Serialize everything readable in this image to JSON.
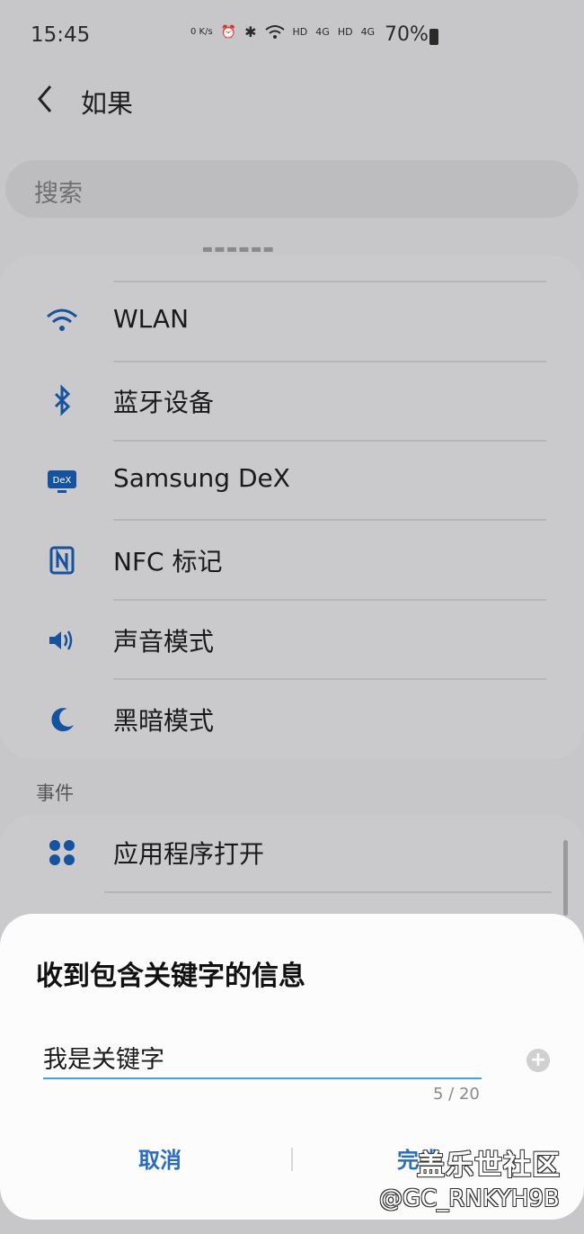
{
  "status_bar": {
    "time": "15:45",
    "net_speed": "0 K/s",
    "hd1": "HD",
    "net1": "4G",
    "hd2": "HD",
    "net2": "4G",
    "battery": "70%"
  },
  "header": {
    "title": "如果"
  },
  "search": {
    "placeholder": "搜索"
  },
  "conditions": {
    "items": [
      {
        "label": "WLAN",
        "icon": "wifi-icon"
      },
      {
        "label": "蓝牙设备",
        "icon": "bluetooth-icon"
      },
      {
        "label": "Samsung DeX",
        "icon": "dex-icon"
      },
      {
        "label": "NFC 标记",
        "icon": "nfc-icon"
      },
      {
        "label": "声音模式",
        "icon": "speaker-icon"
      },
      {
        "label": "黑暗模式",
        "icon": "moon-icon"
      }
    ]
  },
  "events": {
    "section_title": "事件",
    "items": [
      {
        "label": "应用程序打开",
        "icon": "apps-icon"
      }
    ]
  },
  "dialog": {
    "title": "收到包含关键字的信息",
    "input_value": "我是关键字",
    "counter": "5 / 20",
    "cancel_label": "取消",
    "done_label": "完成"
  },
  "watermark": {
    "line1": "盖乐世社区",
    "line2": "@GC_RNKYH9B"
  },
  "colors": {
    "accent": "#2a6dc0",
    "icon_blue": "#16539e",
    "underline": "#4a9fd8"
  }
}
